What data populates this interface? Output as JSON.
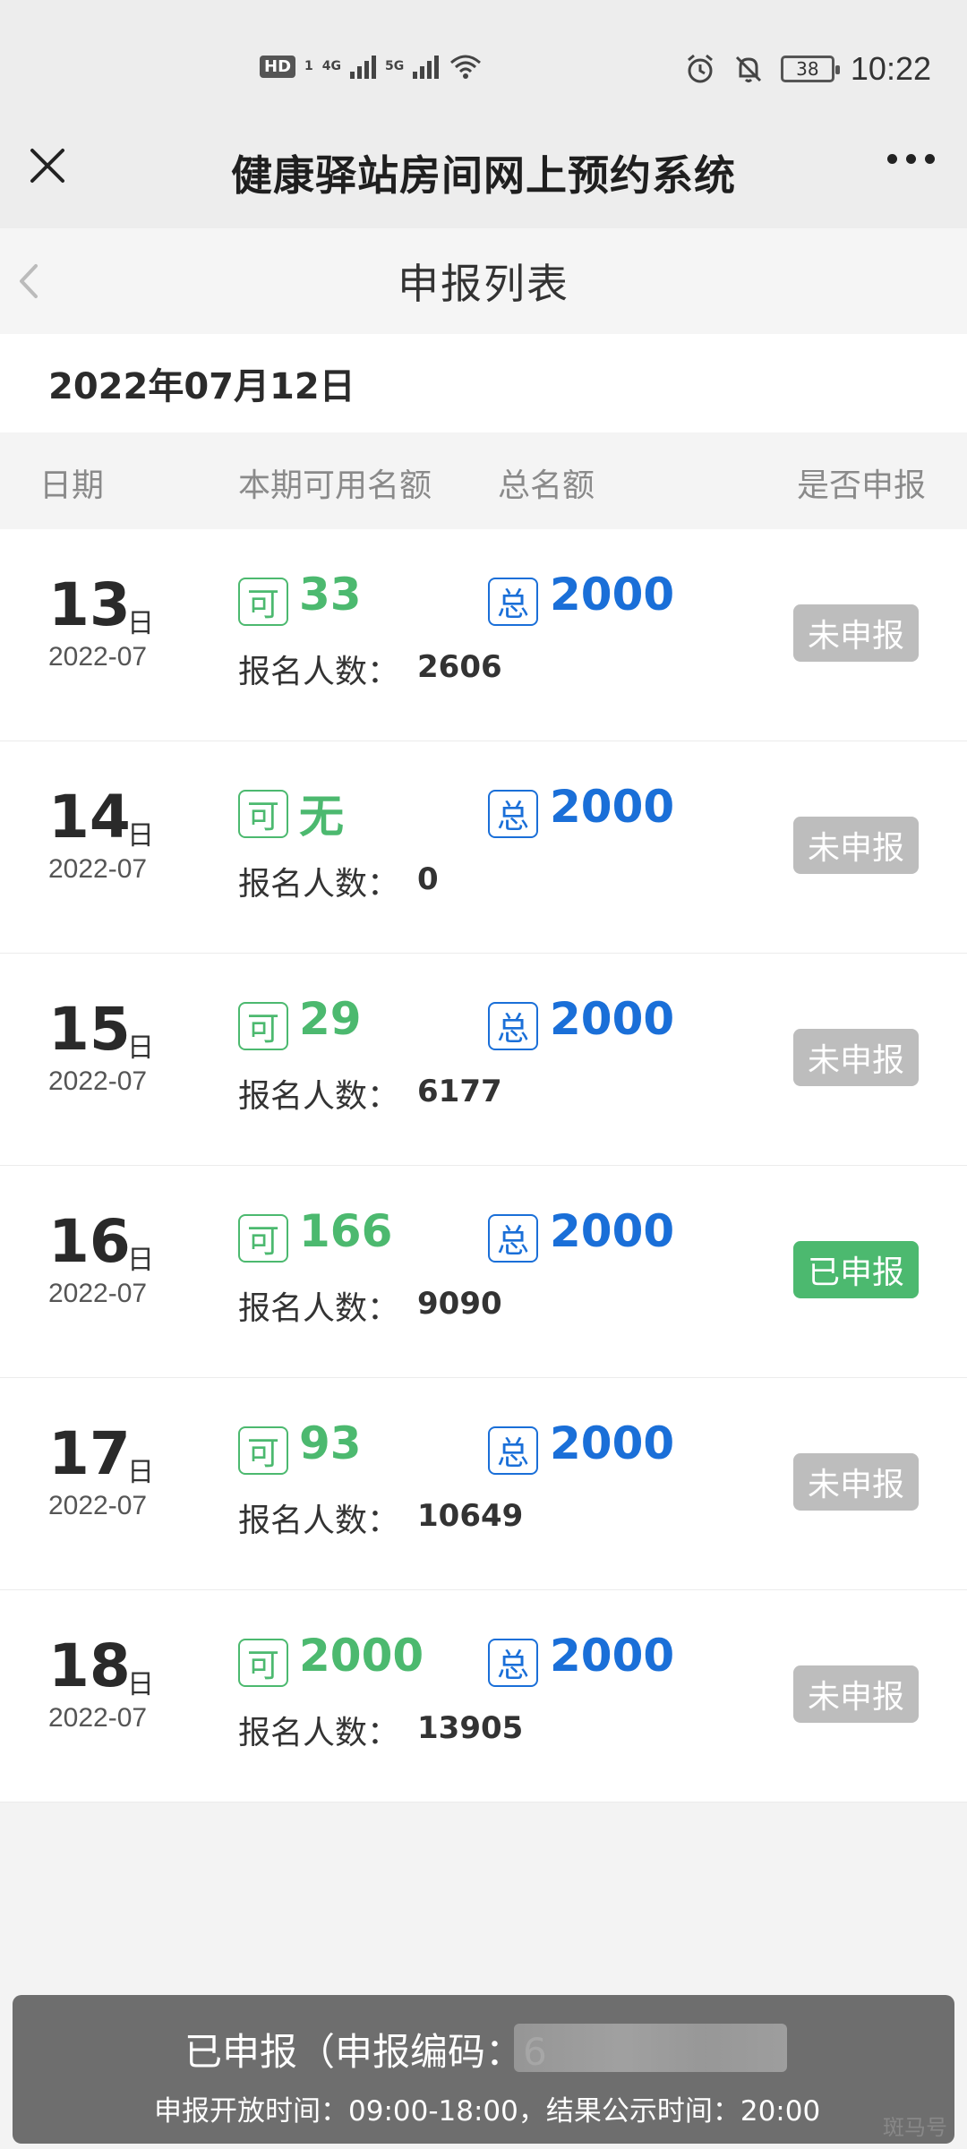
{
  "status_bar": {
    "hd": "HD",
    "sim": "1",
    "net1": "4G",
    "net2": "5G",
    "battery": "38",
    "time": "10:22"
  },
  "header": {
    "title": "健康驿站房间网上预约系统"
  },
  "subheader": {
    "title": "申报列表"
  },
  "date_bar": "2022年07月12日",
  "columns": {
    "date": "日期",
    "available": "本期可用名额",
    "total": "总名额",
    "declared": "是否申报"
  },
  "labels": {
    "ke": "可",
    "zong": "总",
    "day_unit": "日",
    "registered": "报名人数："
  },
  "rows": [
    {
      "day": "13",
      "ym": "2022-07",
      "available": "33",
      "total": "2000",
      "registered": "2606",
      "status": "未申报"
    },
    {
      "day": "14",
      "ym": "2022-07",
      "available": "无",
      "total": "2000",
      "registered": "0",
      "status": "未申报"
    },
    {
      "day": "15",
      "ym": "2022-07",
      "available": "29",
      "total": "2000",
      "registered": "6177",
      "status": "未申报"
    },
    {
      "day": "16",
      "ym": "2022-07",
      "available": "166",
      "total": "2000",
      "registered": "9090",
      "status": "已申报"
    },
    {
      "day": "17",
      "ym": "2022-07",
      "available": "93",
      "total": "2000",
      "registered": "10649",
      "status": "未申报"
    },
    {
      "day": "18",
      "ym": "2022-07",
      "available": "2000",
      "total": "2000",
      "registered": "13905",
      "status": "未申报"
    }
  ],
  "footer": {
    "line1": "已申报（申报编码：6",
    "line2": "申报开放时间：09:00-18:00，结果公示时间：20:00"
  },
  "watermark": "斑马号",
  "colors": {
    "green": "#4cb96f",
    "blue": "#1a6fd8",
    "gray_button": "#bdbdbd"
  }
}
